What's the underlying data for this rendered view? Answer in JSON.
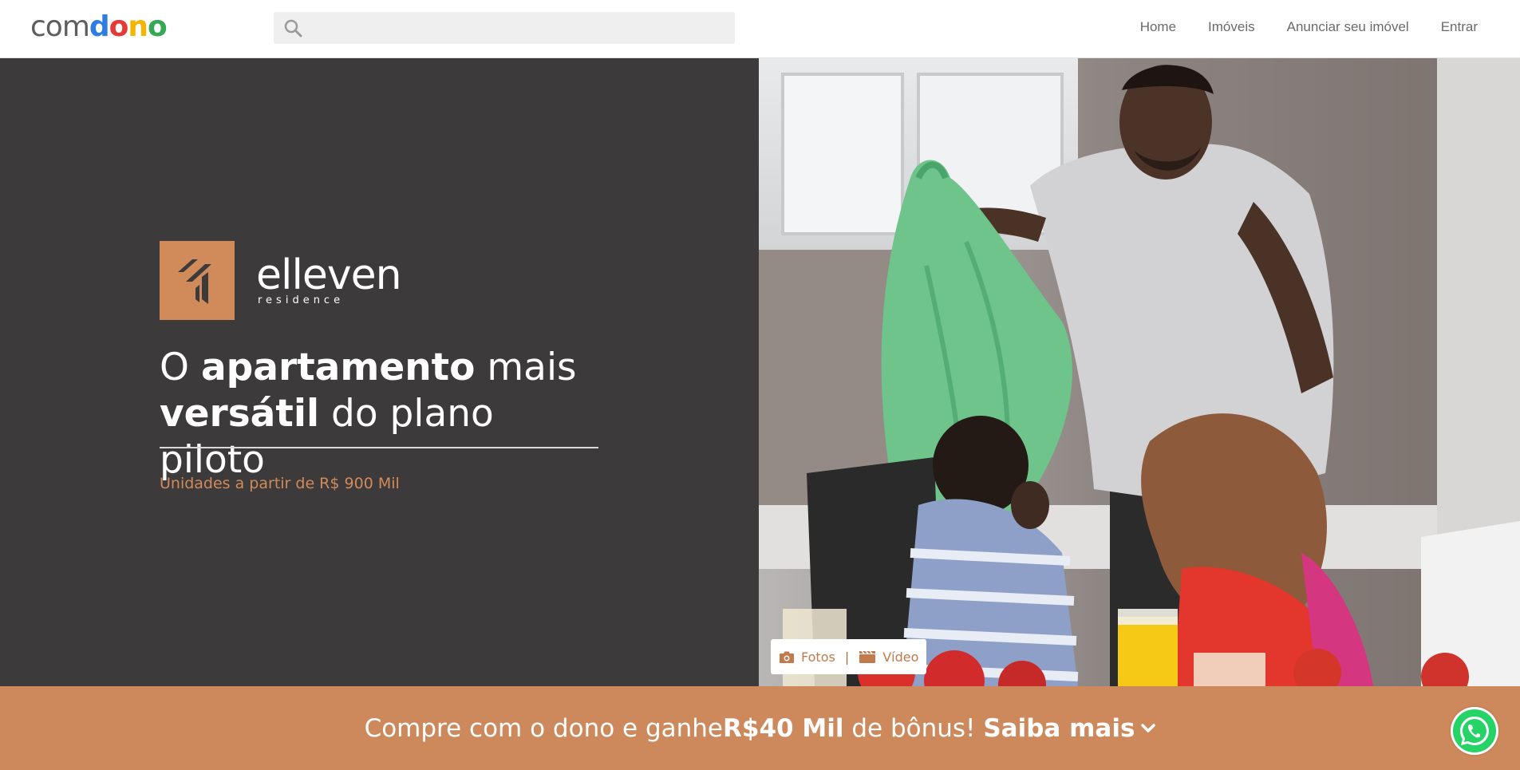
{
  "header": {
    "logo": {
      "part1": "com",
      "d": "d",
      "o1": "o",
      "n": "n",
      "o2": "o"
    },
    "search": {
      "placeholder": "",
      "value": ""
    },
    "nav": [
      "Home",
      "Imóveis",
      "Anunciar seu imóvel",
      "Entrar"
    ]
  },
  "hero": {
    "brand_name": "elleven",
    "brand_sub": "residence",
    "headline": {
      "p1": "O ",
      "b1": "apartamento",
      "p2": " mais ",
      "b2": "versátil",
      "p3": " do plano piloto"
    },
    "price_text": "Unidades a partir de R$ 900 Mil",
    "media_tabs": {
      "photos": "Fotos",
      "separator": "|",
      "video": "Vídeo"
    }
  },
  "promo": {
    "p1": "Compre com o dono e ganhe ",
    "bonus": "R$40 Mil",
    "p2": " de bônus! ",
    "cta": "Saiba mais"
  },
  "colors": {
    "accent": "#cd895c",
    "hero_bg": "#3c3a3b",
    "logo_blue": "#2f7de1",
    "logo_red": "#e53935",
    "logo_yellow": "#f4b400",
    "logo_green": "#34a853",
    "whatsapp_green": "#25d366"
  },
  "icons": {
    "search": "search-icon",
    "camera": "camera-icon",
    "video": "clapperboard-icon",
    "chevron": "chevron-down-icon",
    "whatsapp": "whatsapp-icon"
  }
}
